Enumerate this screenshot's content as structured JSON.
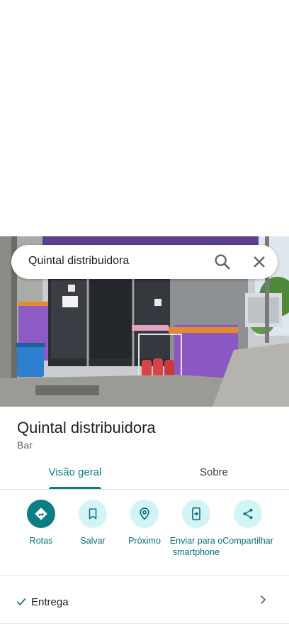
{
  "search": {
    "query": "Quintal distribuidora",
    "search_icon": "search-icon",
    "close_icon": "close-icon"
  },
  "place": {
    "name": "Quintal distribuidora",
    "category": "Bar"
  },
  "tabs": [
    {
      "label": "Visão geral",
      "active": true
    },
    {
      "label": "Sobre",
      "active": false
    }
  ],
  "actions": [
    {
      "label": "Rotas",
      "icon": "directions-icon"
    },
    {
      "label": "Salvar",
      "icon": "bookmark-icon"
    },
    {
      "label": "Próximo",
      "icon": "nearby-icon"
    },
    {
      "label": "Enviar para o smartphone",
      "icon": "send-to-phone-icon"
    },
    {
      "label": "Compartilhar",
      "icon": "share-icon"
    }
  ],
  "attributes": [
    {
      "label": "Entrega",
      "icon": "check-icon"
    }
  ],
  "colors": {
    "accent": "#0b7d84",
    "accent_light": "#d2f4f7",
    "check": "#188038"
  }
}
